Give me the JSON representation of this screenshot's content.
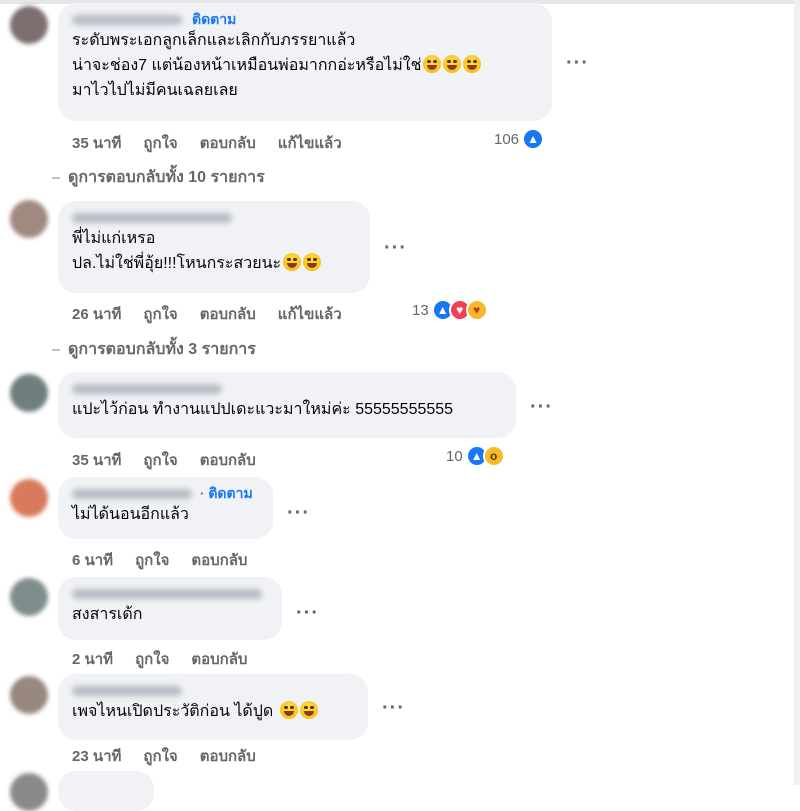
{
  "comments": [
    {
      "follow": "ติดตาม",
      "lines": [
        "ระดับพระเอกลูกเล็กและเลิกกับภรรยาแล้ว",
        "น่าจะช่อง7 แต่น้องหน้าเหมือนพ่อมากกอ่ะหรือไม่ใช่",
        "มาไวไปไม่มีคนเฉลยเลย"
      ],
      "time": "35 นาที",
      "like": "ถูกใจ",
      "reply": "ตอบกลับ",
      "edited": "แก้ไขแล้ว",
      "reaction_count": "106",
      "reactions": [
        "like-icon"
      ]
    },
    {
      "lines": [
        "พี่ไม่แก่เหรอ",
        "ปล.ไม่ใช่พี่อุ้ย!!!โหนกระสวยนะ"
      ],
      "time": "26 นาที",
      "like": "ถูกใจ",
      "reply": "ตอบกลับ",
      "edited": "แก้ไขแล้ว",
      "reaction_count": "13",
      "reactions": [
        "like-icon",
        "love-icon",
        "care-icon"
      ]
    },
    {
      "lines": [
        "แปะไว้ก่อน ทำงานแปปเดะแวะมาใหม่ค่ะ 55555555555"
      ],
      "time": "35 นาที",
      "like": "ถูกใจ",
      "reply": "ตอบกลับ",
      "reaction_count": "10",
      "reactions": [
        "like-icon",
        "wow-icon"
      ]
    },
    {
      "follow": "ติดตาม",
      "lines": [
        "ไม่ได้นอนอีกแล้ว"
      ],
      "time": "6 นาที",
      "like": "ถูกใจ",
      "reply": "ตอบกลับ"
    },
    {
      "lines": [
        "สงสารเด้ก"
      ],
      "time": "2 นาที",
      "like": "ถูกใจ",
      "reply": "ตอบกลับ"
    },
    {
      "lines": [
        "เพจไหนเปิดประวัติก่อน ได้ปูด"
      ],
      "time": "23 นาที",
      "like": "ถูกใจ",
      "reply": "ตอบกลับ"
    }
  ],
  "view_replies": [
    "ดูการตอบกลับทั้ง 10 รายการ",
    "ดูการตอบกลับทั้ง 3 รายการ"
  ],
  "more_icon": "more-horizontal-icon",
  "colors": {
    "link": "#1877f2",
    "bubble": "#f0f2f5",
    "muted": "#65676b",
    "like": "#1877f2",
    "love": "#f33e58"
  }
}
